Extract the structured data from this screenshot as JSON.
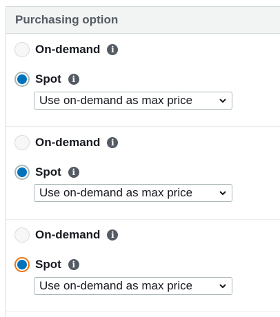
{
  "section": {
    "title": "Purchasing option"
  },
  "options": [
    {
      "on_demand_label": "On-demand",
      "spot_label": "Spot",
      "selected": "Spot",
      "max_price_value": "Use on-demand as max price"
    },
    {
      "on_demand_label": "On-demand",
      "spot_label": "Spot",
      "selected": "Spot",
      "max_price_value": "Use on-demand as max price"
    },
    {
      "on_demand_label": "On-demand",
      "spot_label": "Spot",
      "selected": "Spot",
      "focused": "Spot",
      "max_price_value": "Use on-demand as max price"
    }
  ],
  "icons": {
    "info": "info-icon",
    "chevron": "chevron-down-icon"
  },
  "colors": {
    "radio_checked": "#0073bb",
    "focus_ring": "#ec7211",
    "header_bg": "#f2f3f3"
  }
}
